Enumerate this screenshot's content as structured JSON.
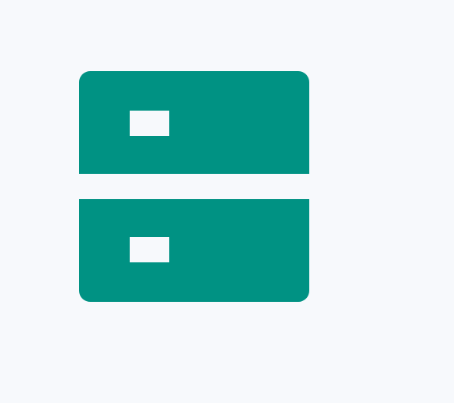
{
  "icon": {
    "name": "server-storage-icon",
    "color": "#009283",
    "slot_color": "#f7f9fc"
  },
  "page": {
    "background": "#f7f9fc"
  }
}
